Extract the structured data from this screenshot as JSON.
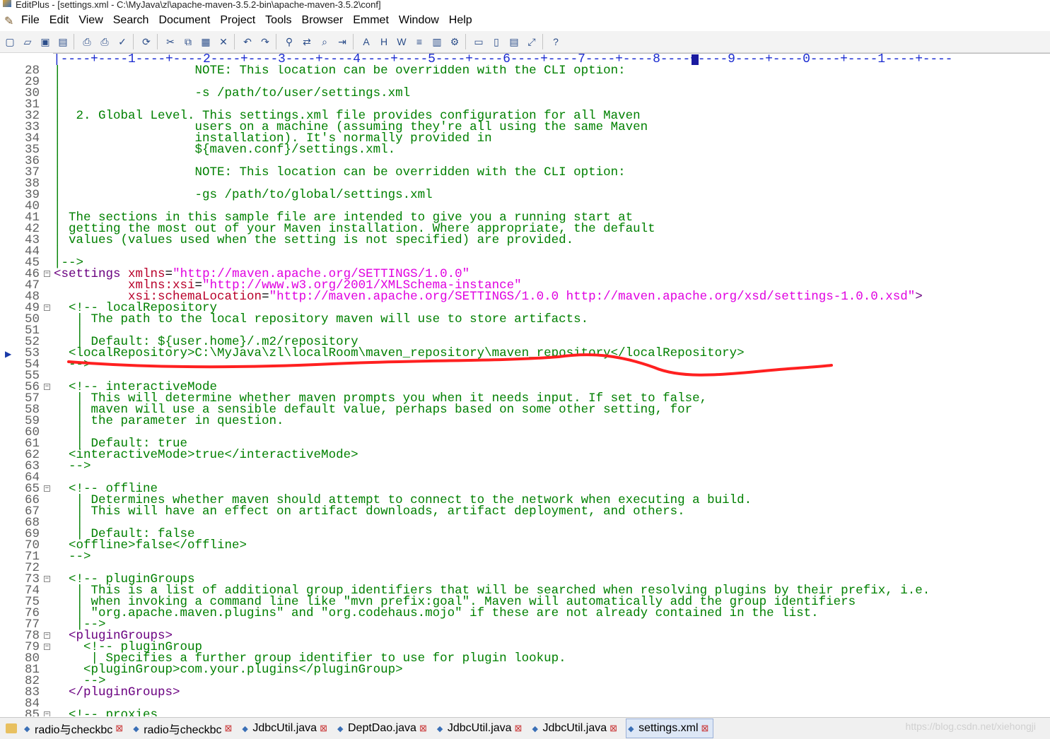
{
  "window": {
    "title": "EditPlus - [settings.xml - C:\\MyJava\\zl\\apache-maven-3.5.2-bin\\apache-maven-3.5.2\\conf]"
  },
  "menu": [
    "File",
    "Edit",
    "View",
    "Search",
    "Document",
    "Project",
    "Tools",
    "Browser",
    "Emmet",
    "Window",
    "Help"
  ],
  "toolbar": {
    "buttons": [
      "new-icon",
      "open-icon",
      "save-icon",
      "save-all-icon",
      "print-preview-icon",
      "print-icon",
      "spell-check-icon",
      "refresh-icon",
      "cut-icon",
      "copy-icon",
      "paste-icon",
      "delete-icon",
      "undo-icon",
      "redo-icon",
      "find-icon",
      "replace-icon",
      "find-in-files-icon",
      "indent-icon",
      "font-icon",
      "hex-icon",
      "word-wrap-icon",
      "line-numbers-icon",
      "column-select-icon",
      "settings-icon",
      "cliptext-icon",
      "directory-icon",
      "output-icon",
      "fullscreen-icon",
      "help-icon"
    ]
  },
  "ruler": {
    "text": "|----+----1----+----2----+----3----+----4----+----5----+----6----+----7----+----8----+----9----+----0----+----1----+----"
  },
  "editor": {
    "current_line": 53,
    "lines": [
      {
        "n": "28",
        "segs": [
          [
            "cm",
            "|                  NOTE: This location can be overridden with the CLI option:"
          ]
        ]
      },
      {
        "n": "29",
        "segs": [
          [
            "cm",
            "|"
          ]
        ]
      },
      {
        "n": "30",
        "segs": [
          [
            "cm",
            "|                  -s /path/to/user/settings.xml"
          ]
        ]
      },
      {
        "n": "31",
        "segs": [
          [
            "cm",
            "|"
          ]
        ]
      },
      {
        "n": "32",
        "segs": [
          [
            "cm",
            "|  2. Global Level. This settings.xml file provides configuration for all Maven"
          ]
        ]
      },
      {
        "n": "33",
        "segs": [
          [
            "cm",
            "|                  users on a machine (assuming they're all using the same Maven"
          ]
        ]
      },
      {
        "n": "34",
        "segs": [
          [
            "cm",
            "|                  installation). It's normally provided in"
          ]
        ]
      },
      {
        "n": "35",
        "segs": [
          [
            "cm",
            "|                  ${maven.conf}/settings.xml."
          ]
        ]
      },
      {
        "n": "36",
        "segs": [
          [
            "cm",
            "|"
          ]
        ]
      },
      {
        "n": "37",
        "segs": [
          [
            "cm",
            "|                  NOTE: This location can be overridden with the CLI option:"
          ]
        ]
      },
      {
        "n": "38",
        "segs": [
          [
            "cm",
            "|"
          ]
        ]
      },
      {
        "n": "39",
        "segs": [
          [
            "cm",
            "|                  -gs /path/to/global/settings.xml"
          ]
        ]
      },
      {
        "n": "40",
        "segs": [
          [
            "cm",
            "|"
          ]
        ]
      },
      {
        "n": "41",
        "segs": [
          [
            "cm",
            "| The sections in this sample file are intended to give you a running start at"
          ]
        ]
      },
      {
        "n": "42",
        "segs": [
          [
            "cm",
            "| getting the most out of your Maven installation. Where appropriate, the default"
          ]
        ]
      },
      {
        "n": "43",
        "segs": [
          [
            "cm",
            "| values (values used when the setting is not specified) are provided."
          ]
        ]
      },
      {
        "n": "44",
        "segs": [
          [
            "cm",
            "|"
          ]
        ]
      },
      {
        "n": "45",
        "segs": [
          [
            "cm",
            "|-->"
          ]
        ]
      },
      {
        "n": "46",
        "fold": true,
        "segs": [
          [
            "tg",
            "<settings "
          ],
          [
            "at",
            "xmlns"
          ],
          [
            "tx",
            "="
          ],
          [
            "st",
            "\"http://maven.apache.org/SETTINGS/1.0.0\""
          ]
        ]
      },
      {
        "n": "47",
        "segs": [
          [
            "tx",
            "          "
          ],
          [
            "at",
            "xmlns:xsi"
          ],
          [
            "tx",
            "="
          ],
          [
            "st",
            "\"http://www.w3.org/2001/XMLSchema-instance\""
          ]
        ]
      },
      {
        "n": "48",
        "segs": [
          [
            "tx",
            "          "
          ],
          [
            "at",
            "xsi:schemaLocation"
          ],
          [
            "tx",
            "="
          ],
          [
            "st",
            "\"http://maven.apache.org/SETTINGS/1.0.0 http://maven.apache.org/xsd/settings-1.0.0.xsd\""
          ],
          [
            "tg",
            ">"
          ]
        ]
      },
      {
        "n": "49",
        "fold": true,
        "segs": [
          [
            "cm",
            "  <!-- localRepository"
          ]
        ]
      },
      {
        "n": "50",
        "segs": [
          [
            "cm",
            "   | The path to the local repository maven will use to store artifacts."
          ]
        ]
      },
      {
        "n": "51",
        "segs": [
          [
            "cm",
            "   |"
          ]
        ]
      },
      {
        "n": "52",
        "segs": [
          [
            "cm",
            "   | Default: ${user.home}/.m2/repository"
          ]
        ]
      },
      {
        "n": "53",
        "marker": true,
        "segs": [
          [
            "cm",
            "  <localRepository>C:\\MyJava\\zl\\localRoom\\maven_repository\\maven_repository</localRepository>"
          ]
        ]
      },
      {
        "n": "54",
        "segs": [
          [
            "cm",
            "  -->"
          ]
        ]
      },
      {
        "n": "55",
        "segs": [
          [
            "tx",
            ""
          ]
        ]
      },
      {
        "n": "56",
        "fold": true,
        "segs": [
          [
            "cm",
            "  <!-- interactiveMode"
          ]
        ]
      },
      {
        "n": "57",
        "segs": [
          [
            "cm",
            "   | This will determine whether maven prompts you when it needs input. If set to false,"
          ]
        ]
      },
      {
        "n": "58",
        "segs": [
          [
            "cm",
            "   | maven will use a sensible default value, perhaps based on some other setting, for"
          ]
        ]
      },
      {
        "n": "59",
        "segs": [
          [
            "cm",
            "   | the parameter in question."
          ]
        ]
      },
      {
        "n": "60",
        "segs": [
          [
            "cm",
            "   |"
          ]
        ]
      },
      {
        "n": "61",
        "segs": [
          [
            "cm",
            "   | Default: true"
          ]
        ]
      },
      {
        "n": "62",
        "segs": [
          [
            "cm",
            "  <interactiveMode>true</interactiveMode>"
          ]
        ]
      },
      {
        "n": "63",
        "segs": [
          [
            "cm",
            "  -->"
          ]
        ]
      },
      {
        "n": "64",
        "segs": [
          [
            "tx",
            ""
          ]
        ]
      },
      {
        "n": "65",
        "fold": true,
        "segs": [
          [
            "cm",
            "  <!-- offline"
          ]
        ]
      },
      {
        "n": "66",
        "segs": [
          [
            "cm",
            "   | Determines whether maven should attempt to connect to the network when executing a build."
          ]
        ]
      },
      {
        "n": "67",
        "segs": [
          [
            "cm",
            "   | This will have an effect on artifact downloads, artifact deployment, and others."
          ]
        ]
      },
      {
        "n": "68",
        "segs": [
          [
            "cm",
            "   |"
          ]
        ]
      },
      {
        "n": "69",
        "segs": [
          [
            "cm",
            "   | Default: false"
          ]
        ]
      },
      {
        "n": "70",
        "segs": [
          [
            "cm",
            "  <offline>false</offline>"
          ]
        ]
      },
      {
        "n": "71",
        "segs": [
          [
            "cm",
            "  -->"
          ]
        ]
      },
      {
        "n": "72",
        "segs": [
          [
            "tx",
            ""
          ]
        ]
      },
      {
        "n": "73",
        "fold": true,
        "segs": [
          [
            "cm",
            "  <!-- pluginGroups"
          ]
        ]
      },
      {
        "n": "74",
        "segs": [
          [
            "cm",
            "   | This is a list of additional group identifiers that will be searched when resolving plugins by their prefix, i.e."
          ]
        ]
      },
      {
        "n": "75",
        "segs": [
          [
            "cm",
            "   | when invoking a command line like \"mvn prefix:goal\". Maven will automatically add the group identifiers"
          ]
        ]
      },
      {
        "n": "76",
        "segs": [
          [
            "cm",
            "   | \"org.apache.maven.plugins\" and \"org.codehaus.mojo\" if these are not already contained in the list."
          ]
        ]
      },
      {
        "n": "77",
        "segs": [
          [
            "cm",
            "   |-->"
          ]
        ]
      },
      {
        "n": "78",
        "fold": true,
        "segs": [
          [
            "tx",
            "  "
          ],
          [
            "tg",
            "<pluginGroups>"
          ]
        ]
      },
      {
        "n": "79",
        "fold": true,
        "segs": [
          [
            "cm",
            "    <!-- pluginGroup"
          ]
        ]
      },
      {
        "n": "80",
        "segs": [
          [
            "cm",
            "     | Specifies a further group identifier to use for plugin lookup."
          ]
        ]
      },
      {
        "n": "81",
        "segs": [
          [
            "cm",
            "    <pluginGroup>com.your.plugins</pluginGroup>"
          ]
        ]
      },
      {
        "n": "82",
        "segs": [
          [
            "cm",
            "    -->"
          ]
        ]
      },
      {
        "n": "83",
        "segs": [
          [
            "tx",
            "  "
          ],
          [
            "tg",
            "</pluginGroups>"
          ]
        ]
      },
      {
        "n": "84",
        "segs": [
          [
            "tx",
            ""
          ]
        ]
      },
      {
        "n": "85",
        "fold": true,
        "segs": [
          [
            "cm",
            "  <!-- proxies"
          ]
        ]
      }
    ]
  },
  "tabs": [
    {
      "label": "radio与checkbc",
      "active": false
    },
    {
      "label": "radio与checkbc",
      "active": false
    },
    {
      "label": "JdbcUtil.java",
      "active": false
    },
    {
      "label": "DeptDao.java",
      "active": false
    },
    {
      "label": "JdbcUtil.java",
      "active": false
    },
    {
      "label": "JdbcUtil.java",
      "active": false
    },
    {
      "label": "settings.xml",
      "active": true
    }
  ],
  "watermark": "https://blog.csdn.net/xiehongji",
  "colors": {
    "comment": "#008000",
    "tag": "#6a0080",
    "attribute": "#b8002a",
    "string": "#e000e0",
    "annotation": "#ff2020"
  }
}
